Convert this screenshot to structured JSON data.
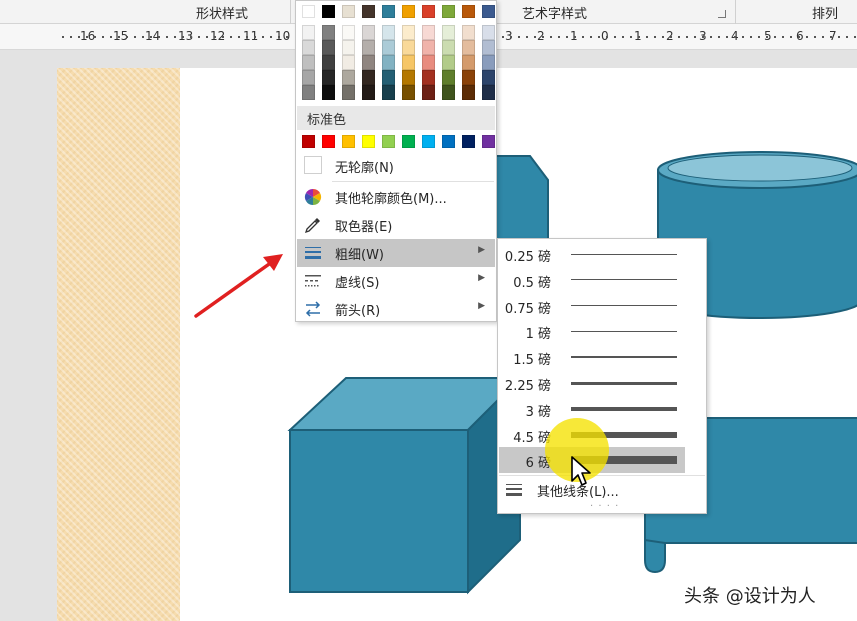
{
  "ribbon": {
    "groups": [
      "形状样式",
      "艺术字样式",
      "排列"
    ]
  },
  "ruler": {
    "labels": [
      "16",
      "15",
      "14",
      "13",
      "12",
      "11",
      "10",
      "3",
      "2",
      "1",
      "0",
      "1",
      "2",
      "3",
      "4",
      "5",
      "6",
      "7"
    ]
  },
  "color_menu": {
    "standard_colors_label": "标准色",
    "theme_top_row": [
      "#ffffff",
      "#000000",
      "#e7e0d2",
      "#44342b",
      "#2e7e9a",
      "#f0a000",
      "#d9402a",
      "#7ea83a",
      "#b8580a",
      "#3b5a8f"
    ],
    "standard_colors": [
      "#c00000",
      "#ff0000",
      "#ffc000",
      "#ffff00",
      "#92d050",
      "#00b050",
      "#00b0f0",
      "#0070c0",
      "#002060",
      "#7030a0"
    ],
    "items": {
      "no_outline": "无轮廓(N)",
      "more_colors": "其他轮廓颜色(M)...",
      "eyedropper": "取色器(E)",
      "weight": "粗细(W)",
      "dashes": "虚线(S)",
      "arrows": "箭头(R)"
    },
    "highlighted_item": "粗细(W)"
  },
  "weight_menu": {
    "options": [
      {
        "label": "0.25 磅",
        "pt": 0.25
      },
      {
        "label": "0.5 磅",
        "pt": 0.5
      },
      {
        "label": "0.75 磅",
        "pt": 0.75
      },
      {
        "label": "1 磅",
        "pt": 1
      },
      {
        "label": "1.5 磅",
        "pt": 1.5
      },
      {
        "label": "2.25 磅",
        "pt": 2.25
      },
      {
        "label": "3 磅",
        "pt": 3
      },
      {
        "label": "4.5 磅",
        "pt": 4.5
      },
      {
        "label": "6 磅",
        "pt": 6
      }
    ],
    "selected": "6 磅",
    "more_lines": "其他线条(L)..."
  },
  "watermark": "头条 @设计为人",
  "colors": {
    "shape_fill": "#2f88a8",
    "shape_dark": "#1e6e8c",
    "shape_top": "#5aa9c4",
    "menu_highlight": "#c6c6c6",
    "annotation_arrow": "#e02020"
  }
}
